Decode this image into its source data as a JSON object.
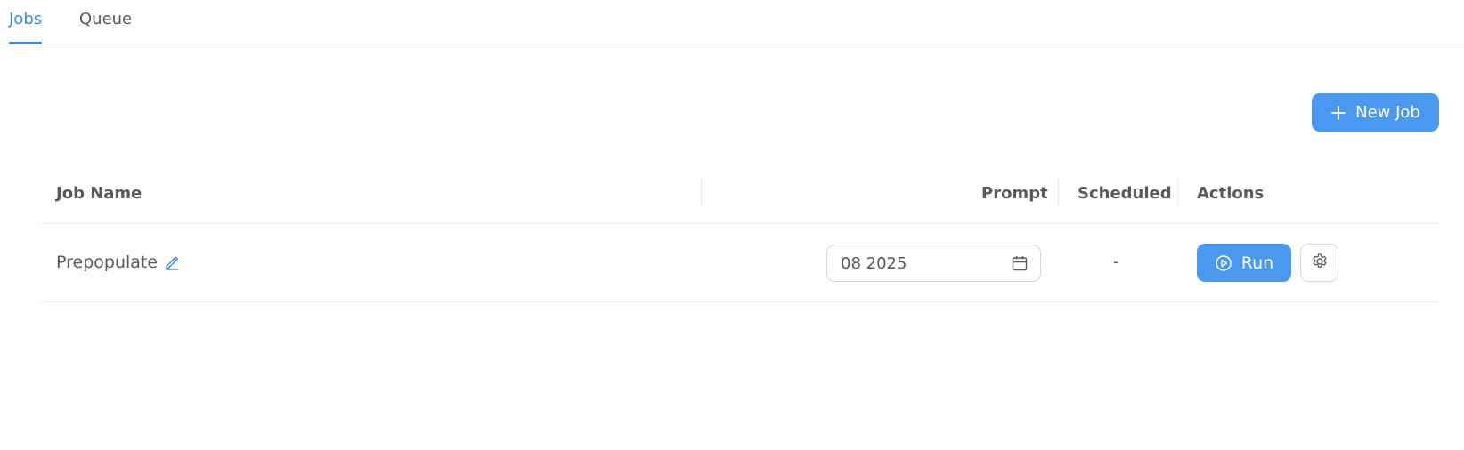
{
  "tabs": [
    {
      "label": "Jobs",
      "active": true
    },
    {
      "label": "Queue",
      "active": false
    }
  ],
  "toolbar": {
    "new_job_label": "New Job",
    "new_job_icon": "plus-icon"
  },
  "table": {
    "headers": {
      "job_name": "Job Name",
      "prompt": "Prompt",
      "scheduled": "Scheduled",
      "actions": "Actions"
    },
    "rows": [
      {
        "job_name": "Prepopulate",
        "prompt_value": "08 2025",
        "scheduled": "-",
        "run_label": "Run"
      }
    ]
  },
  "icons": {
    "edit": "pencil-icon",
    "calendar": "calendar-icon",
    "run": "play-circle-icon",
    "settings": "gear-icon"
  },
  "colors": {
    "accent": "#4a98ef",
    "active_tab": "#3b8ae8",
    "text": "#595959",
    "border": "#eeeeee"
  }
}
